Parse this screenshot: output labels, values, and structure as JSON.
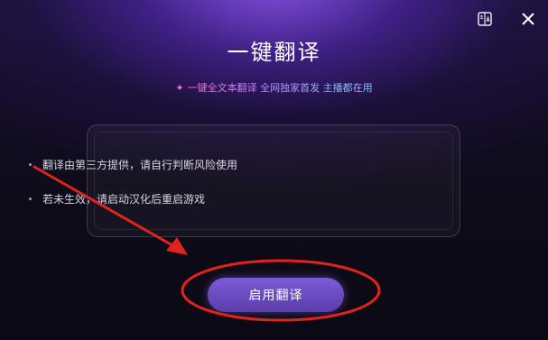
{
  "header": {
    "title": "一键翻译",
    "subtitle": "一键全文本翻译 全网独家首发 主播都在用"
  },
  "notice": {
    "items": [
      "翻译由第三方提供，请自行判断风险使用",
      "若未生效，请启动汉化后重启游戏"
    ]
  },
  "actions": {
    "enable_label": "启用翻译"
  },
  "icons": {
    "language": "translate-book-icon",
    "close": "close-icon",
    "sparkle": "sparkle-icon"
  },
  "colors": {
    "accent": "#6a4bc4",
    "annotation": "#e0241c"
  }
}
